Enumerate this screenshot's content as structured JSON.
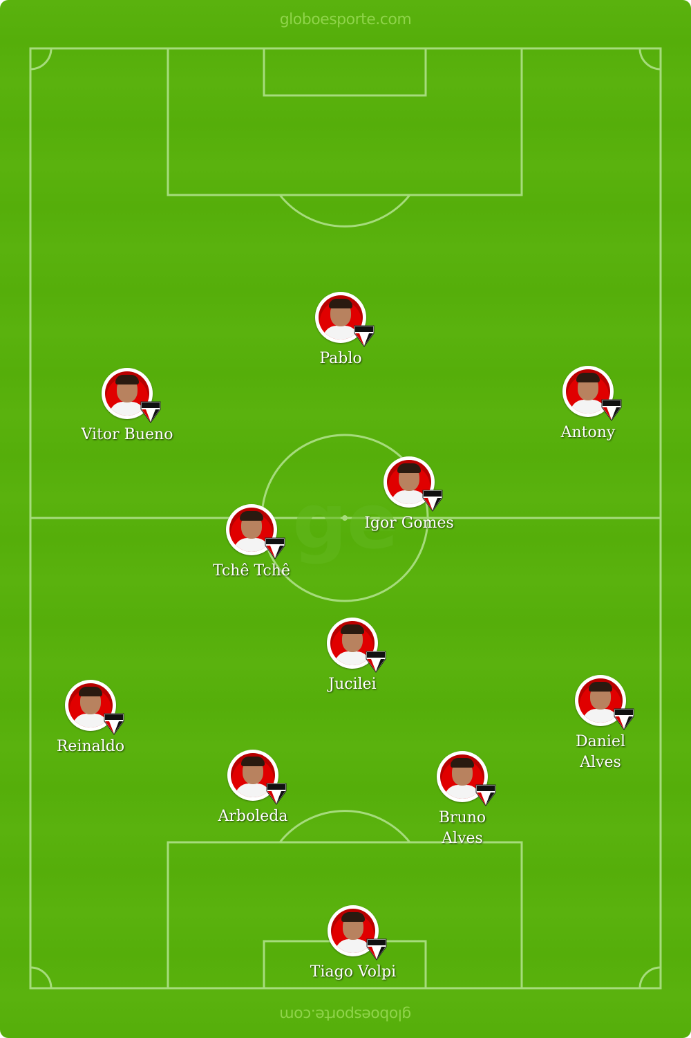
{
  "brand": {
    "top_text": "globoesporte.com",
    "bottom_text": "globoesporte.com",
    "watermark": "ge"
  },
  "colors": {
    "grass": "#5ab20e",
    "lines": "#a6dc7c",
    "avatar_background": "#e00000",
    "name_text": "#ffffff"
  },
  "players": [
    {
      "name": "Pablo",
      "icon": "player-photo",
      "badge": "sao-paulo-fc-badge"
    },
    {
      "name": "Vitor Bueno",
      "icon": "player-photo",
      "badge": "sao-paulo-fc-badge"
    },
    {
      "name": "Antony",
      "icon": "player-photo",
      "badge": "sao-paulo-fc-badge"
    },
    {
      "name": "Igor Gomes",
      "icon": "player-photo",
      "badge": "sao-paulo-fc-badge"
    },
    {
      "name": "Tchê Tchê",
      "icon": "player-photo",
      "badge": "sao-paulo-fc-badge"
    },
    {
      "name": "Jucilei",
      "icon": "player-photo",
      "badge": "sao-paulo-fc-badge"
    },
    {
      "name": "Reinaldo",
      "icon": "player-photo",
      "badge": "sao-paulo-fc-badge"
    },
    {
      "name": "Daniel Alves",
      "icon": "player-photo",
      "badge": "sao-paulo-fc-badge"
    },
    {
      "name": "Arboleda",
      "icon": "player-photo",
      "badge": "sao-paulo-fc-badge"
    },
    {
      "name": "Bruno Alves",
      "icon": "player-photo",
      "badge": "sao-paulo-fc-badge"
    },
    {
      "name": "Tiago Volpi",
      "icon": "player-photo",
      "badge": "sao-paulo-fc-badge"
    }
  ]
}
